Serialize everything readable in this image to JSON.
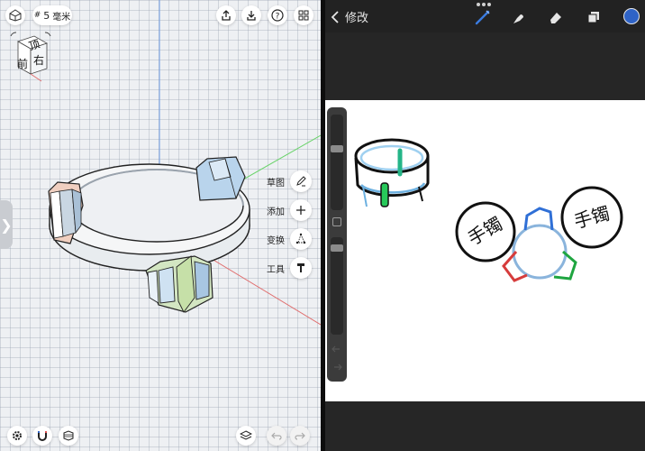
{
  "cad": {
    "unit_badge": {
      "prefix": "#",
      "value": "5",
      "unit": "毫米"
    },
    "view_cube": {
      "top_label": "顶",
      "front_label": "前",
      "right_label": "右"
    },
    "tools": [
      {
        "label": "草图",
        "icon": "pencil-icon"
      },
      {
        "label": "添加",
        "icon": "plus-icon"
      },
      {
        "label": "变换",
        "icon": "transform-icon"
      },
      {
        "label": "工具",
        "icon": "hammer-icon"
      }
    ],
    "top_icons": [
      "export-icon",
      "download-icon",
      "help-icon",
      "grid-menu-icon"
    ],
    "bottom_icons": [
      "settings-icon",
      "magnet-icon",
      "material-icon",
      "layers-icon",
      "undo-icon",
      "redo-icon"
    ],
    "side_handle_glyph": "❯"
  },
  "draw": {
    "back_label": "修改",
    "top_icons": [
      "brush-icon",
      "smudge-icon",
      "eraser-icon",
      "layers-icon"
    ],
    "color_hex": "#2f63c6",
    "sketch": {
      "left_circle_text": "手镯",
      "right_circle_text": "手镯"
    }
  }
}
